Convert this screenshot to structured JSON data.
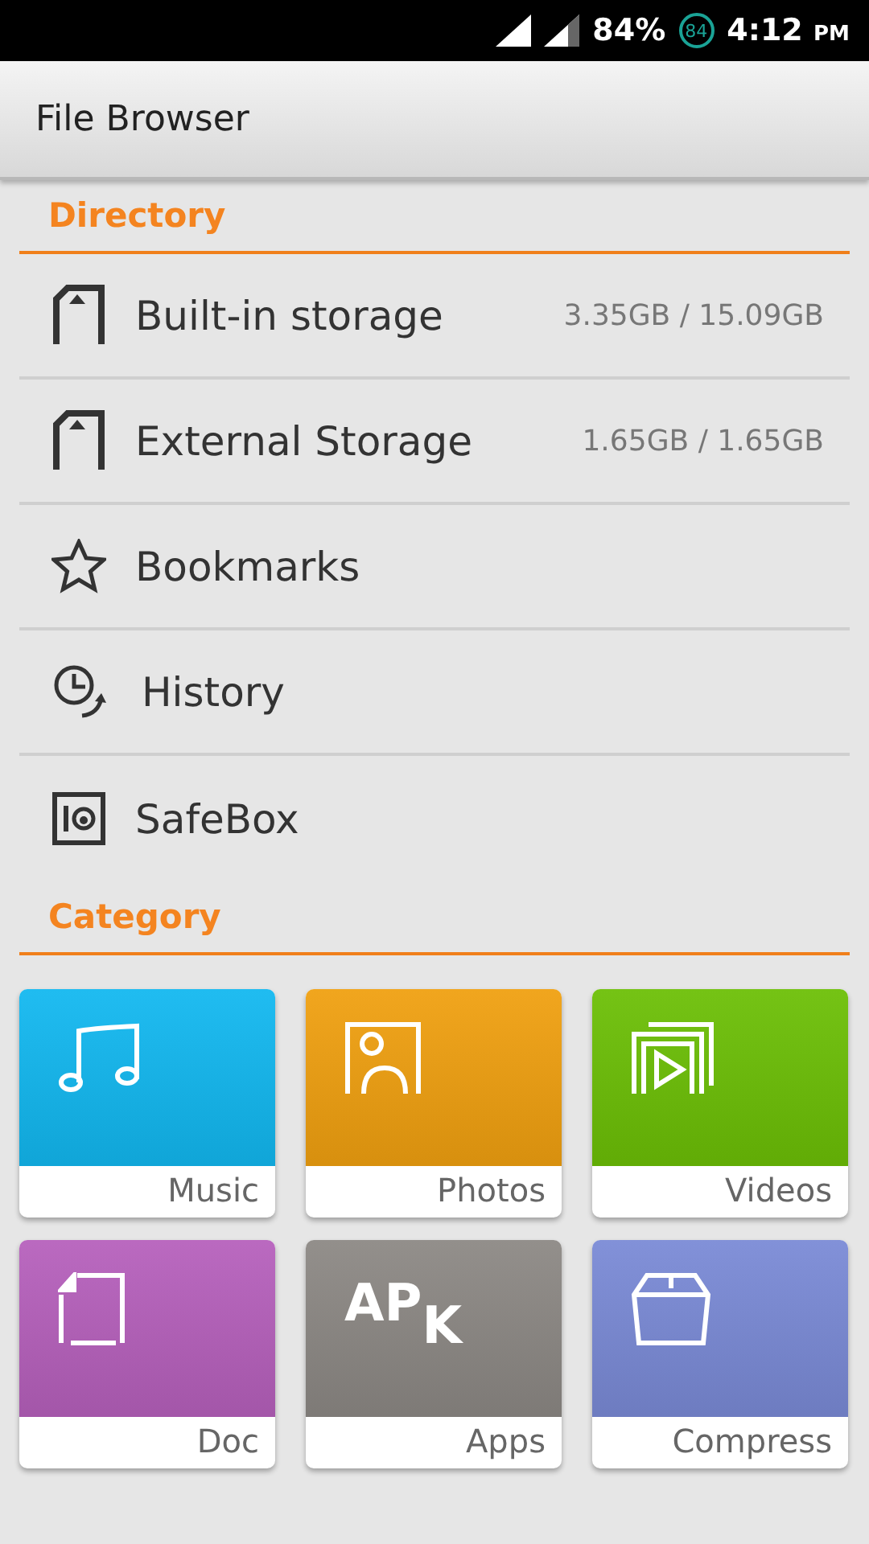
{
  "status_bar": {
    "battery_percent": "84%",
    "battery_badge": "84",
    "time": "4:12",
    "meridiem": "PM"
  },
  "title_bar": {
    "title": "File Browser"
  },
  "directory": {
    "heading": "Directory",
    "items": [
      {
        "kind": "storage",
        "label": "Built-in storage",
        "usage": "3.35GB / 15.09GB"
      },
      {
        "kind": "storage",
        "label": "External Storage",
        "usage": "1.65GB / 1.65GB"
      },
      {
        "kind": "bookmarks",
        "label": "Bookmarks"
      },
      {
        "kind": "history",
        "label": "History"
      },
      {
        "kind": "safebox",
        "label": "SafeBox"
      }
    ]
  },
  "category": {
    "heading": "Category",
    "tiles": [
      {
        "kind": "music",
        "label": "Music",
        "color": "#12b8f0"
      },
      {
        "kind": "photos",
        "label": "Photos",
        "color": "#f0a010"
      },
      {
        "kind": "videos",
        "label": "Videos",
        "color": "#6cbf06"
      },
      {
        "kind": "doc",
        "label": "Doc",
        "color": "#b660bc"
      },
      {
        "kind": "apps",
        "label": "Apps",
        "color": "#8c8884",
        "icon_text": "AP$_{K}$"
      },
      {
        "kind": "compress",
        "label": "Compress",
        "color": "#7a8ad6"
      }
    ]
  }
}
